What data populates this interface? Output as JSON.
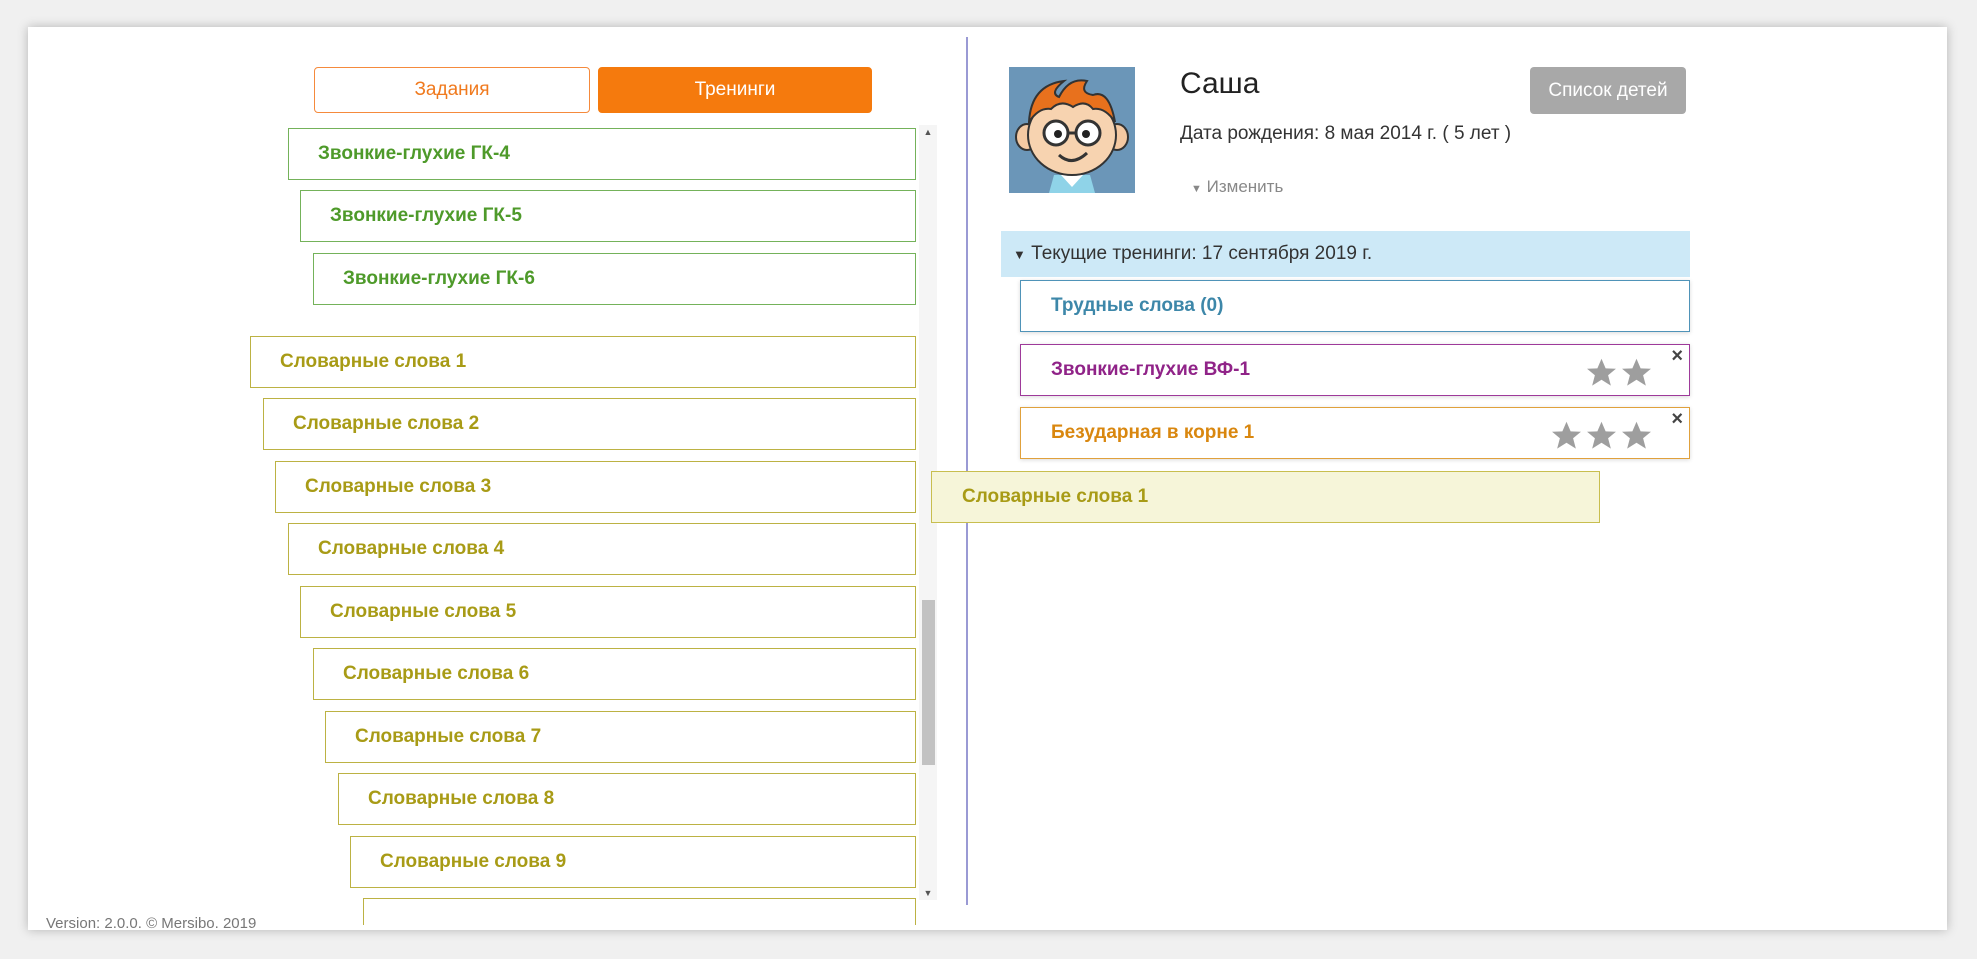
{
  "tabs": {
    "tasks": "Задания",
    "trainings": "Тренинги"
  },
  "training_list": [
    {
      "label": "Звонкие-глухие ГК-4",
      "color": "green"
    },
    {
      "label": "Звонкие-глухие ГК-5",
      "color": "green"
    },
    {
      "label": "Звонкие-глухие ГК-6",
      "color": "green"
    },
    {
      "label": "Словарные слова 1",
      "color": "olive"
    },
    {
      "label": "Словарные слова 2",
      "color": "olive"
    },
    {
      "label": "Словарные слова 3",
      "color": "olive"
    },
    {
      "label": "Словарные слова 4",
      "color": "olive"
    },
    {
      "label": "Словарные слова 5",
      "color": "olive"
    },
    {
      "label": "Словарные слова 6",
      "color": "olive"
    },
    {
      "label": "Словарные слова 7",
      "color": "olive"
    },
    {
      "label": "Словарные слова 8",
      "color": "olive"
    },
    {
      "label": "Словарные слова 9",
      "color": "olive"
    },
    {
      "label": "",
      "color": "olive"
    }
  ],
  "child": {
    "name": "Саша",
    "birth": "Дата рождения: 8 мая 2014 г. ( 5 лет )",
    "edit": "Изменить"
  },
  "children_list_button": "Список детей",
  "current": {
    "header": "Текущие тренинги: 17 сентября 2019 г.",
    "hard_words": "Трудные слова (0)",
    "items": [
      {
        "label": "Звонкие-глухие ВФ-1",
        "stars": 2
      },
      {
        "label": "Безударная в корне 1",
        "stars": 3
      }
    ]
  },
  "dragging_item": "Словарные слова 1",
  "footer": "Version: 2.0.0. © Mersibo. 2019",
  "colors": {
    "accent": "#f57a0d",
    "green": "#4e9a2a",
    "olive": "#a89b16"
  }
}
